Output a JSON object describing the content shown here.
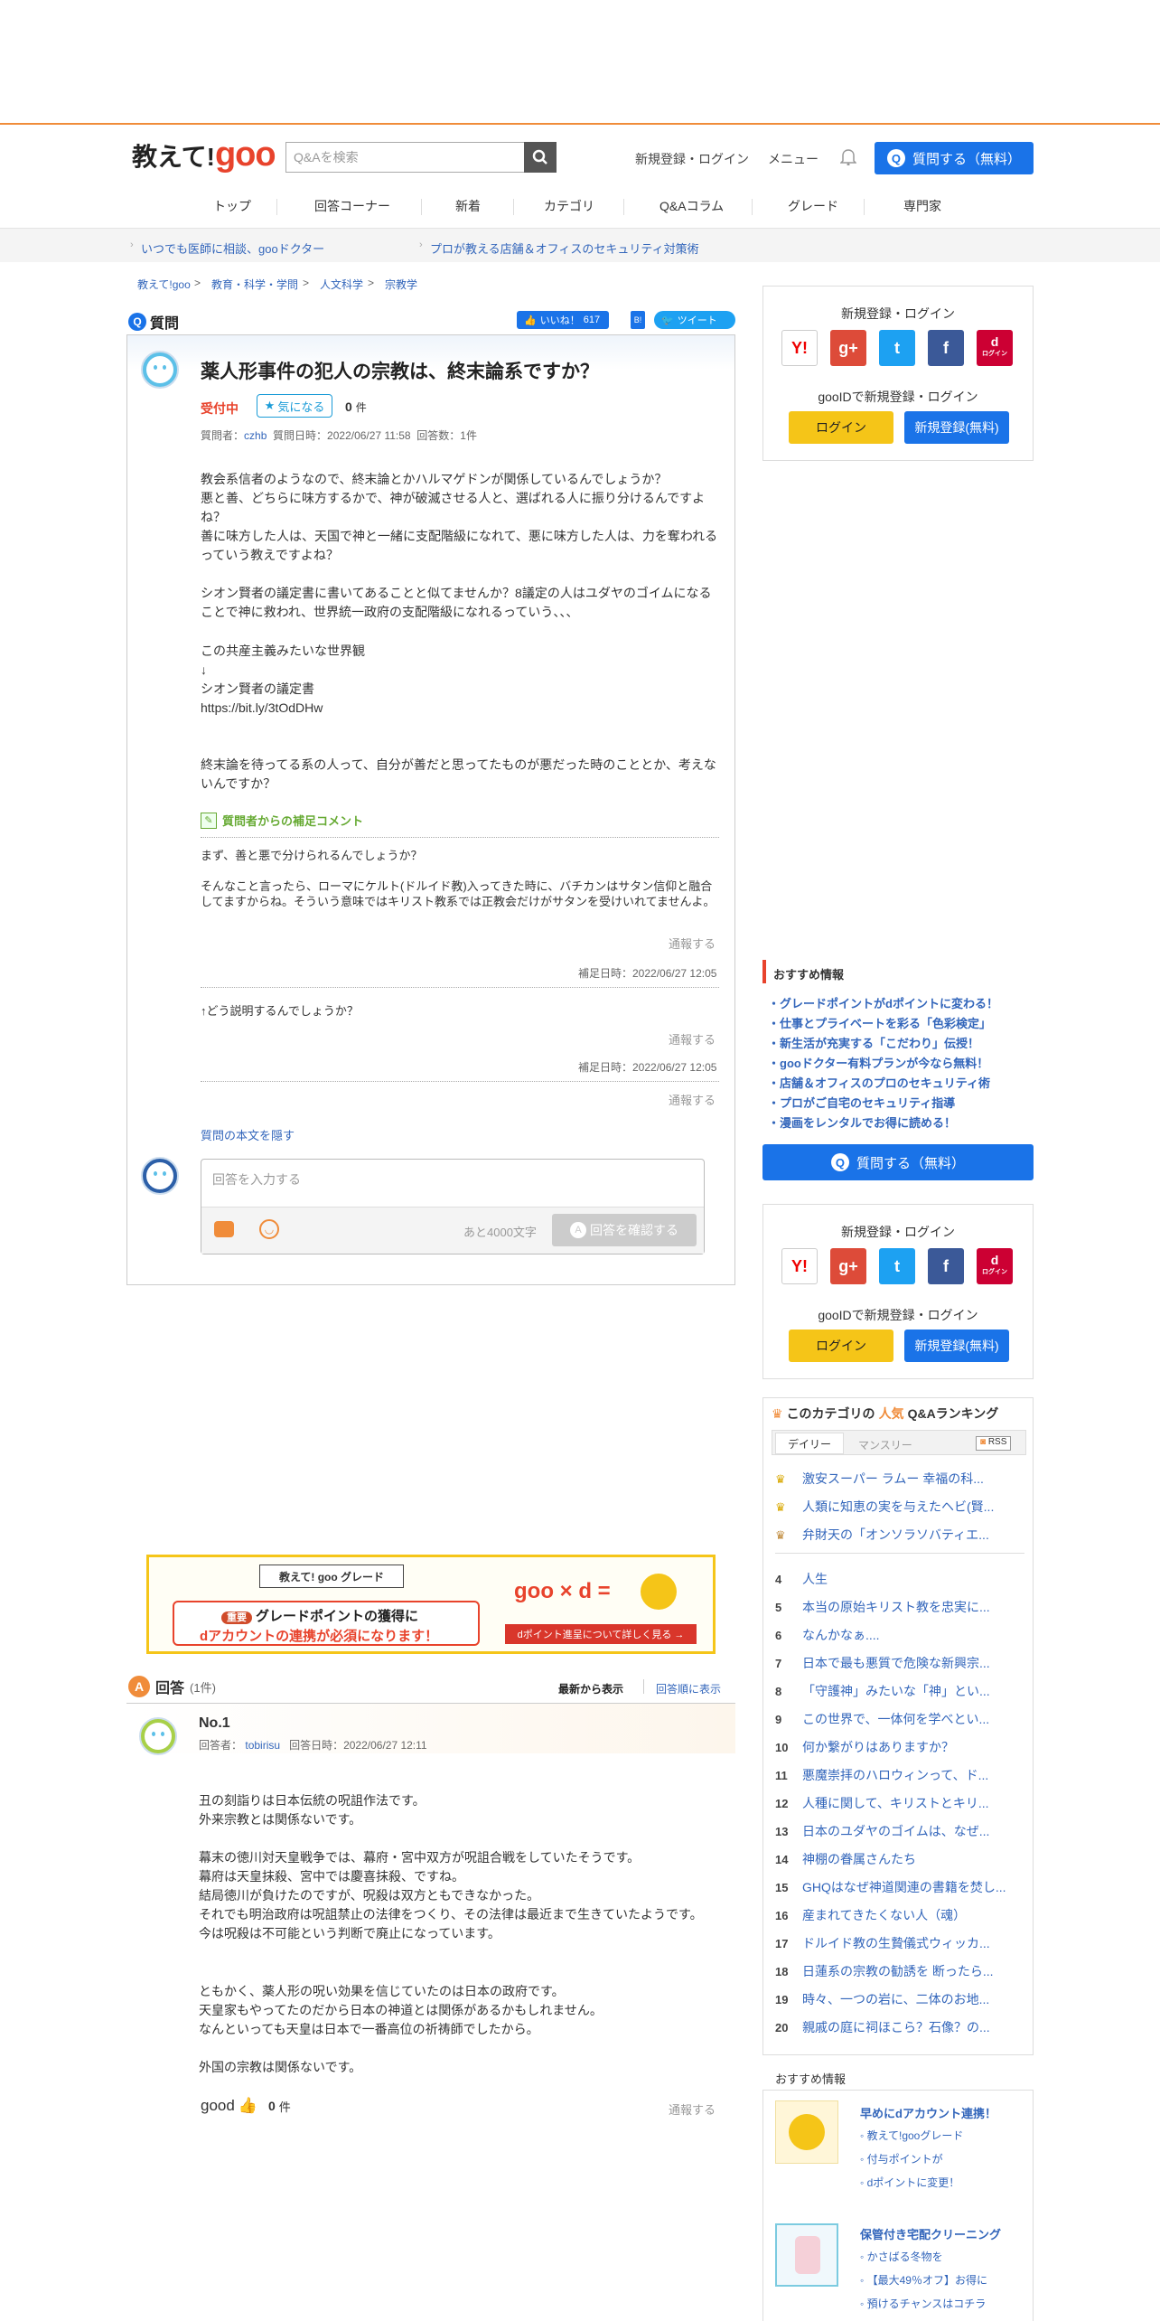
{
  "header": {
    "logo_text": "教えて!",
    "logo_goo": "goo",
    "search_placeholder": "Q&Aを検索",
    "login_link": "新規登録・ログイン",
    "menu_link": "メニュー",
    "ask_button": "質問する（無料）"
  },
  "nav": [
    "トップ",
    "回答コーナー",
    "新着",
    "カテゴリ",
    "Q&Aコラム",
    "グレード",
    "専門家"
  ],
  "promo": [
    "いつでも医師に相談、gooドクター",
    "プロが教える店舗＆オフィスのセキュリティ対策術"
  ],
  "breadcrumb": [
    "教えて!goo",
    "教育・科学・学問",
    "人文科学",
    "宗教学"
  ],
  "question": {
    "label": "質問",
    "like_label": "いいね！",
    "like_count": "617",
    "tweet_label": "ツイート",
    "title": "薬人形事件の犯人の宗教は、終末論系ですか？",
    "status": "受付中",
    "watch_label": "気になる",
    "watch_count": "0",
    "watch_unit": "件",
    "meta_asker_label": "質問者：",
    "meta_asker": "czhb",
    "meta_date": "質問日時：2022/06/27 11:58",
    "meta_answers": "回答数：1件",
    "body1": "教会系信者のようなので、終末論とかハルマゲドンが関係しているんでしょうか？\n悪と善、どちらに味方するかで、神が破滅させる人と、選ばれる人に振り分けるんですよね？\n善に味方した人は、天国で神と一緒に支配階級になれて、悪に味方した人は、力を奪われるっていう教えですよね？",
    "body2": "シオン賢者の議定書に書いてあることと似てませんか？8議定の人はユダヤのゴイムになることで神に救われ、世界統一政府の支配階級になれるっていう、、、",
    "body3": "この共産主義みたいな世界観\n↓\nシオン賢者の議定書",
    "body_link": "https://bit.ly/3tOdDHw",
    "body4": "終末論を待ってる系の人って、自分が善だと思ってたものが悪だった時のこととか、考えないんですか？",
    "supp_header": "質問者からの補足コメント",
    "supp1": "まず、善と悪で分けられるんでしょうか？\n\nそんなこと言ったら、ローマにケルト(ドルイド教)入ってきた時に、バチカンはサタン信仰と融合してますからね。そういう意味ではキリスト教系では正教会だけがサタンを受けいれてませんよ。",
    "report": "通報する",
    "supp_date1": "補足日時：2022/06/27 12:05",
    "supp2": "↑どう説明するんでしょうか？",
    "supp_date2": "補足日時：2022/06/27 12:05",
    "hide_link": "質問の本文を隠す",
    "answer_placeholder": "回答を入力する",
    "char_remaining": "あと4000文字",
    "confirm_button": "回答を確認する"
  },
  "grade_banner": {
    "tag": "教えて! goo グレード",
    "badge": "重要",
    "line1": "グレードポイントの獲得に",
    "line2": "dアカウントの連携が必須になります！",
    "logo": "goo × d = ",
    "button": "dポイント進呈について詳しく見る →"
  },
  "answers": {
    "label": "回答",
    "count": "(1件)",
    "sort_new": "最新から表示",
    "sort_old": "回答順に表示",
    "items": [
      {
        "no": "No.1",
        "user_label": "回答者：",
        "user": "tobirisu",
        "date": "回答日時：2022/06/27 12:11",
        "p1": "丑の刻詣りは日本伝統の呪詛作法です。\n外来宗教とは関係ないです。",
        "p2": "幕末の徳川対天皇戦争では、幕府・宮中双方が呪詛合戦をしていたそうです。\n幕府は天皇抹殺、宮中では慶喜抹殺、ですね。\n結局徳川が負けたのですが、呪殺は双方ともできなかった。\nそれでも明治政府は呪詛禁止の法律をつくり、その法律は最近まで生きていたようです。\n今は呪殺は不可能という判断で廃止になっています。",
        "p3": "ともかく、薬人形の呪い効果を信じていたのは日本の政府です。\n天皇家もやってたのだから日本の神道とは関係があるかもしれません。\nなんといっても天皇は日本で一番高位の祈祷師でしたから。",
        "p4": "外国の宗教は関係ないです。",
        "good_label": "good",
        "good_count": "0",
        "good_unit": "件",
        "report": "通報する"
      }
    ]
  },
  "sidebar": {
    "login_title": "新規登録・ログイン",
    "goo_id": "gooIDで新規登録・ログイン",
    "login_btn": "ログイン",
    "register_btn": "新規登録(無料)",
    "sns": [
      "Y!",
      "g+",
      "t",
      "f",
      "d"
    ],
    "d_login": "ログイン",
    "rec_title": "おすすめ情報",
    "rec_items": [
      "・グレードポイントがdポイントに変わる！",
      "・仕事とプライベートを彩る「色彩検定」",
      "・新生活が充実する「こだわり」伝授！",
      "・gooドクター有料プランが今なら無料！",
      "・店舗＆オフィスのプロのセキュリティ術",
      "・プロがご自宅のセキュリティ指導",
      "・漫画をレンタルでお得に読める！"
    ],
    "ask_btn": "質問する（無料）",
    "rank_title_pre": "このカテゴリの",
    "rank_title_hl": "人気",
    "rank_title_post": "Q&Aランキング",
    "tab_daily": "デイリー",
    "tab_monthly": "マンスリー",
    "rss": "RSS",
    "ranking": [
      "激安スーパー ラムー 幸福の科...",
      "人類に知恵の実を与えたヘビ(賢...",
      "弁財天の「オンソラソバティエ...",
      "人生",
      "本当の原始キリスト教を忠実に...",
      "なんかなぁ....",
      "日本で最も悪質で危険な新興宗...",
      "「守護神」みたいな「神」とい...",
      "この世界で、一体何を学べとい...",
      "何か繋がりはありますか？",
      "悪魔崇拝のハロウィンって、ド...",
      "人種に関して、キリストとキリ...",
      "日本のユダヤのゴイムは、なぜ...",
      "神棚の眷属さんたち",
      "GHQはなぜ神道関連の書籍を焚し...",
      "産まれてきたくない人（魂）",
      "ドルイド教の生贄儀式ウィッカ...",
      "日蓮系の宗教の勧誘を 断ったら...",
      "時々、一つの岩に、二体のお地...",
      "親戚の庭に祠ほこら？石像？の..."
    ],
    "rec2_title": "おすすめ情報",
    "rec2_a_title": "早めにdアカウント連携！",
    "rec2_a_items": [
      "教えて!gooグレード",
      "付与ポイントが",
      "dポイントに変更！"
    ],
    "rec2_b_title": "保管付き宅配クリーニング",
    "rec2_b_items": [
      "かさばる冬物を",
      "【最大49％オフ】お得に",
      "預けるチャンスはコチラ"
    ]
  },
  "colors": {
    "accent": "#1a73e8",
    "brand": "#e8432c",
    "orange": "#f08c3a"
  }
}
